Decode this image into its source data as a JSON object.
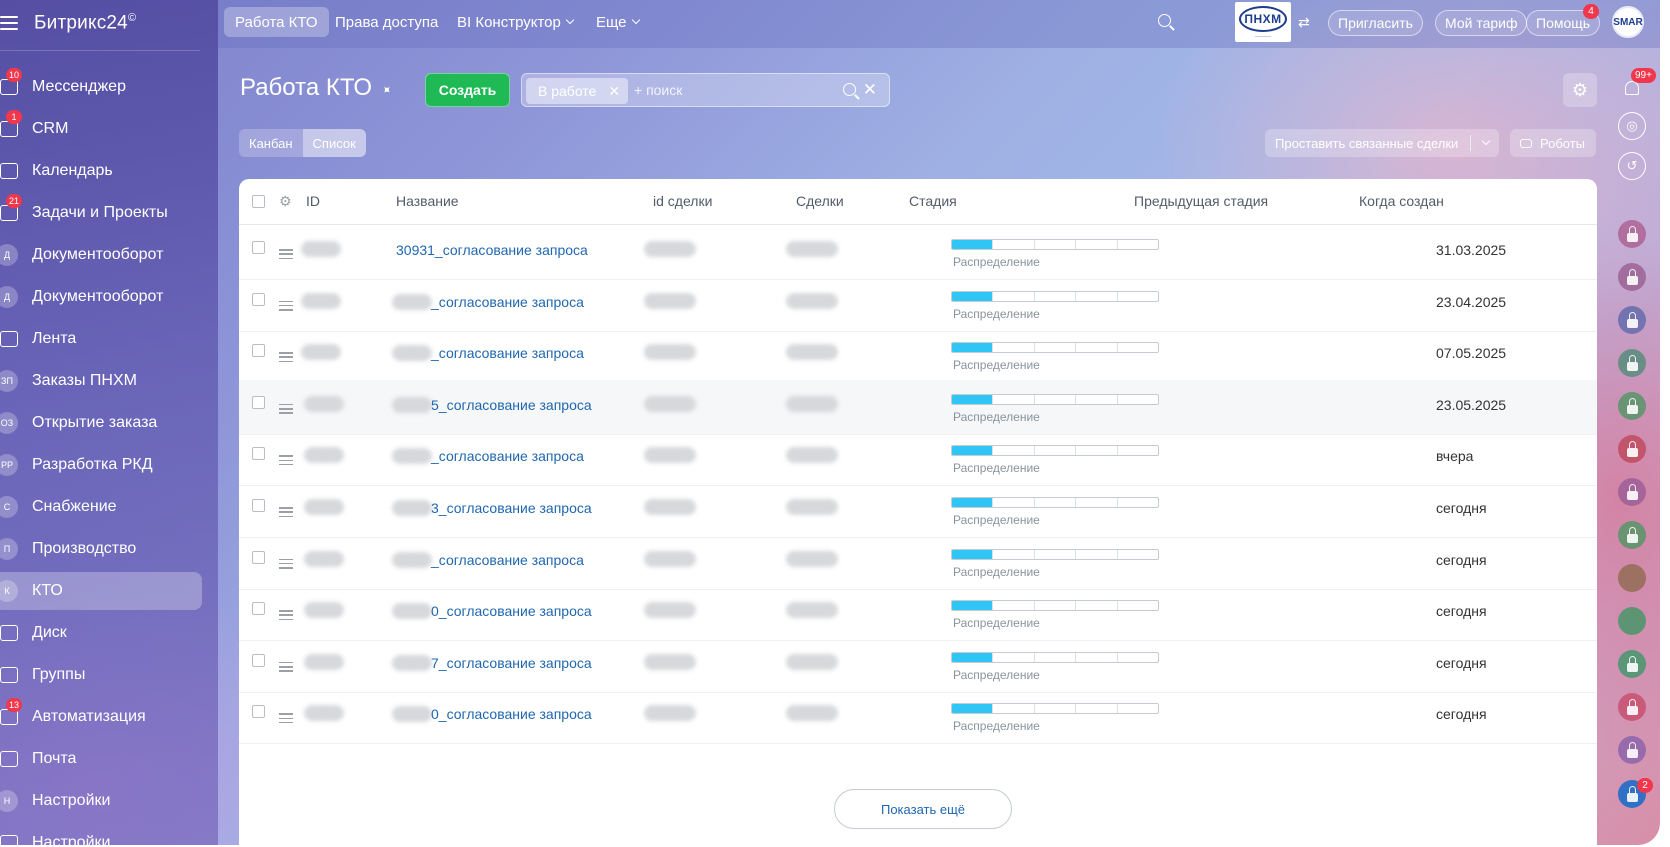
{
  "app": {
    "brand": "Битрикс24",
    "brand_mark": "©"
  },
  "sidebar": {
    "items": [
      {
        "label": "Мессенджер",
        "badge": "10",
        "icon": "chat-icon"
      },
      {
        "label": "CRM",
        "badge": "1",
        "icon": "funnel-icon"
      },
      {
        "label": "Календарь",
        "badge": "",
        "icon": "calendar-icon"
      },
      {
        "label": "Задачи и Проекты",
        "badge": "21",
        "icon": "tasks-icon"
      },
      {
        "label": "Документооборот",
        "badge": "",
        "letter": "Д"
      },
      {
        "label": "Документооборот",
        "badge": "",
        "letter": "Д"
      },
      {
        "label": "Лента",
        "badge": "",
        "icon": "feed-icon"
      },
      {
        "label": "Заказы ПНХМ",
        "badge": "",
        "letter": "ЗП"
      },
      {
        "label": "Открытие заказа",
        "badge": "",
        "letter": "ОЗ"
      },
      {
        "label": "Разработка РКД",
        "badge": "",
        "letter": "РР"
      },
      {
        "label": "Снабжение",
        "badge": "",
        "letter": "С"
      },
      {
        "label": "Производство",
        "badge": "",
        "letter": "П"
      },
      {
        "label": "КТО",
        "badge": "",
        "letter": "К",
        "active": true
      },
      {
        "label": "Диск",
        "badge": "",
        "icon": "disk-icon"
      },
      {
        "label": "Группы",
        "badge": "",
        "icon": "groups-icon"
      },
      {
        "label": "Автоматизация",
        "badge": "13",
        "icon": "automation-icon"
      },
      {
        "label": "Почта",
        "badge": "",
        "icon": "mail-icon"
      },
      {
        "label": "Настройки",
        "badge": "",
        "letter": "Н"
      },
      {
        "label": "Настройки",
        "badge": "",
        "icon": "settings-icon"
      }
    ]
  },
  "topbar": {
    "tabs": [
      "Работа КТО",
      "Права доступа",
      "BI Конструктор",
      "Еще"
    ],
    "invite": "Пригласить",
    "plan": "Мой тариф",
    "help": "Помощь",
    "help_badge": "4",
    "company_logo_text": "ПНХМ",
    "avatar_text": "SMAR"
  },
  "page": {
    "title": "Работа КТО",
    "create": "Создать",
    "filter_tag": "В работе",
    "search_placeholder": "+ поиск",
    "views": [
      "Канбан",
      "Список"
    ],
    "link_deals": "Проставить связанные сделки",
    "robots": "Роботы",
    "notification_badge": "99+",
    "rail_badge": "2"
  },
  "table": {
    "columns": [
      "ID",
      "Название",
      "id сделки",
      "Сделки",
      "Стадия",
      "Предыдущая стадия",
      "Когда создан"
    ],
    "stage_segments": 5,
    "rows": [
      {
        "name": "30931_согласование запроса",
        "stage": "Распределение",
        "created": "31.03.2025"
      },
      {
        "name": "_согласование запроса",
        "stage": "Распределение",
        "created": "23.04.2025"
      },
      {
        "name": "_согласование запроса",
        "stage": "Распределение",
        "created": "07.05.2025"
      },
      {
        "name": "5_согласование запроса",
        "stage": "Распределение",
        "created": "23.05.2025"
      },
      {
        "name": "_согласование запроса",
        "stage": "Распределение",
        "created": "вчера"
      },
      {
        "name": "3_согласование запроса",
        "stage": "Распределение",
        "created": "сегодня"
      },
      {
        "name": "_согласование запроса",
        "stage": "Распределение",
        "created": "сегодня"
      },
      {
        "name": "0_согласование запроса",
        "stage": "Распределение",
        "created": "сегодня"
      },
      {
        "name": "7_согласование запроса",
        "stage": "Распределение",
        "created": "сегодня"
      },
      {
        "name": "0_согласование запроса",
        "stage": "Распределение",
        "created": "сегодня"
      }
    ],
    "show_more": "Показать ещё"
  },
  "colors": {
    "accent_green": "#1fba56",
    "link_blue": "#2067b0",
    "progress_fill": "#2fc6f6",
    "badge_red": "#f0374b"
  }
}
